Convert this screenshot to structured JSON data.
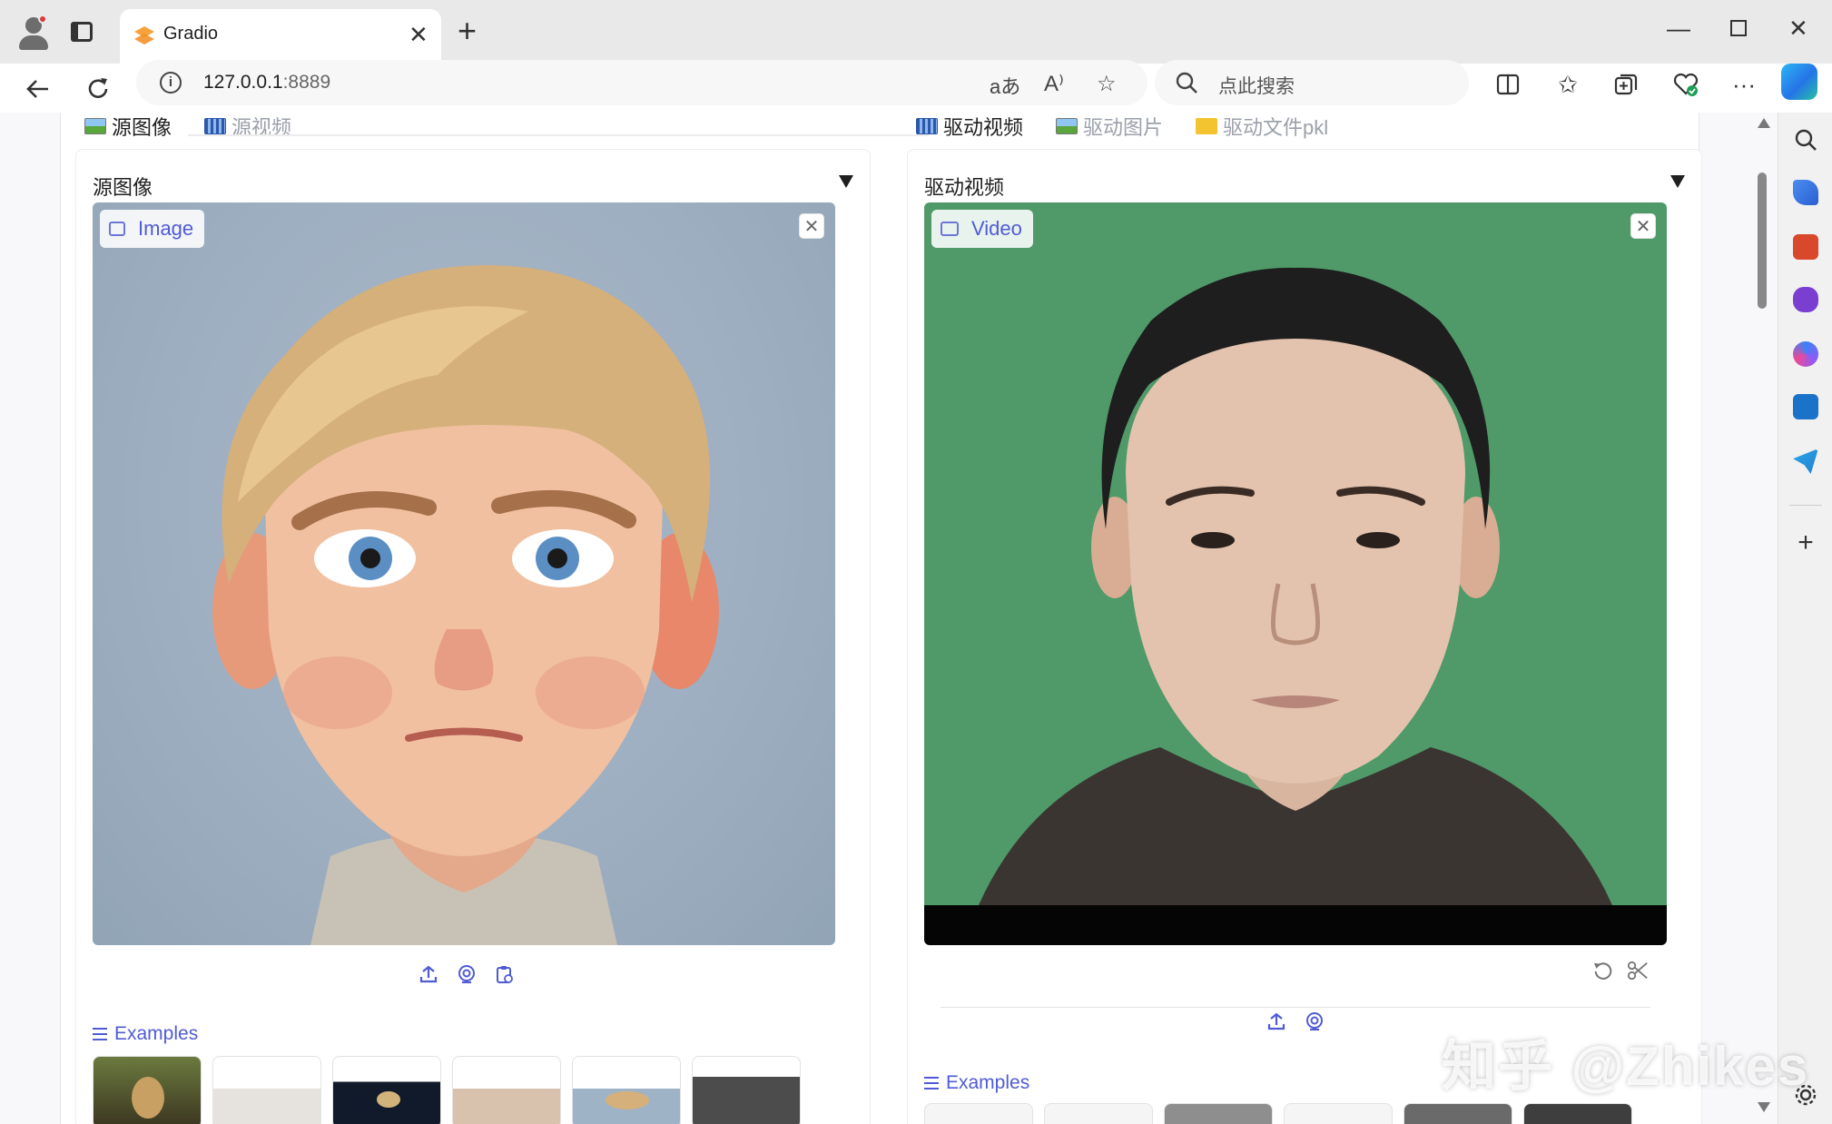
{
  "browser": {
    "tab_title": "Gradio",
    "url_host": "127.0.0.1",
    "url_port": ":8889",
    "search_placeholder": "点此搜索"
  },
  "left": {
    "tabs": [
      {
        "label": "源图像",
        "active": true
      },
      {
        "label": "源视频",
        "active": false
      }
    ],
    "panel_label": "源图像",
    "badge": "Image",
    "examples_label": "Examples"
  },
  "right": {
    "tabs": [
      {
        "label": "驱动视频",
        "active": true
      },
      {
        "label": "驱动图片",
        "active": false
      },
      {
        "label": "驱动文件pkl",
        "active": false
      }
    ],
    "panel_label": "驱动视频",
    "badge": "Video",
    "examples_label": "Examples"
  },
  "watermark": "知乎 @Zhikes",
  "colors": {
    "accent": "#4f5bd5",
    "green_screen": "#4f9a68",
    "cartoon_bg": "#9eafc1"
  }
}
